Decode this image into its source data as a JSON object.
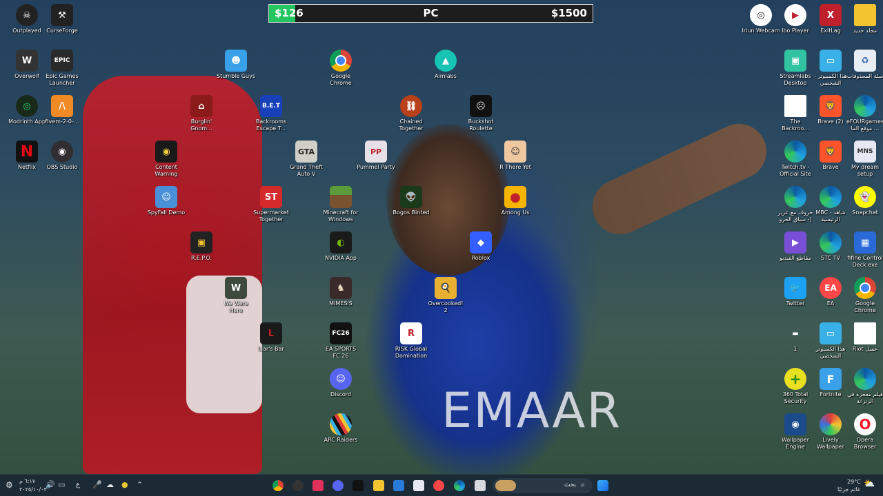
{
  "top_bar": {
    "left": "$126",
    "center": "PC",
    "right": "$1500",
    "progress": 0.08
  },
  "wallpaper": {
    "jersey_text": "EMAAR"
  },
  "icons": {
    "outplayed": "Outplayed",
    "curseforge": "CurseForge",
    "overwolf": "Overwolf",
    "epic": "Epic Games Launcher",
    "modrinth": "Modrinth App",
    "fivem": "fivem-2-0-...",
    "netflix": "Netflix",
    "obs": "OBS Studio",
    "content_warning": "Content Warning",
    "spyfall": "SpyFall Demo",
    "burglin": "Burglin' Gnom...",
    "repo": "R.E.P.O.",
    "stumble": "Stumble Guys",
    "backrooms_escape": "Backrooms Escape T...",
    "supermarket": "Supermarket Together",
    "we_were_here": "We Were Here",
    "liars_bar": "Liar's Bar",
    "chrome_mid": "Google Chrome",
    "gta": "Grand Theft Auto V",
    "minecraft": "Minecraft for Windows",
    "nvidia": "NVIDIA App",
    "mimesis": "MIMESIS",
    "fc26": "EA SPORTS FC 26",
    "discord": "Discord",
    "arc": "ARC Raiders",
    "chained": "Chained Together",
    "pummel": "Pummel Party",
    "bogos": "Bogos Binted",
    "risk": "RISK Global Domination",
    "overcooked": "Overcooked! 2",
    "aimlabs": "Aimlabs",
    "buckshot": "Buckshot Roulette",
    "r_there": "R There Yet",
    "among_us": "Among Us",
    "roblox": "Roblox",
    "iriun": "Iriun Webcam",
    "ibo": "Ibo Player",
    "exitlag": "ExitLag",
    "new_folder": "مجلد جديد",
    "streamlabs": "Streamlabs Desktop",
    "this_pc_1": "هذا الكمبيوتر - الشخصي",
    "recycle": "سلة المحذوفات",
    "backrooms_file": "The Backroo...",
    "brave2": "Brave (2)",
    "efour": "eFOURgames موقع الما ...",
    "twitch": "Twitch.tv - Official Site",
    "brave": "Brave",
    "dream": "My dream setup",
    "letters": "حروف مع عزيز - سباق الحرو)",
    "shahid": "MBC - شاهد الرئيسية",
    "snapchat": "Snapchat",
    "videos": "مقاطع الفيديو",
    "stctv": "STC TV",
    "fifine": "fifine Control Deck.exe",
    "twitter": "Twitter",
    "ea": "EA",
    "chrome_right": "Google Chrome",
    "one": "1",
    "this_pc_2": "هذا الكمبيوتر الشخصي",
    "riot": "Riot عميل",
    "total360": "360 Total Security",
    "fortnite": "Fortnite",
    "miracle": "فيلم معجزة في الزنزانة",
    "wallpaper_engine": "Wallpaper Engine",
    "lively": "Lively Wallpaper",
    "opera": "Opera Browser"
  },
  "taskbar": {
    "search_placeholder": "بحث",
    "weather_temp": "29°C",
    "weather_desc": "غائم جزئيًا",
    "clock_time": "٦:١٧ م",
    "clock_date": "٢٠٢٥/١٠/٠٣",
    "lang": "ع"
  }
}
